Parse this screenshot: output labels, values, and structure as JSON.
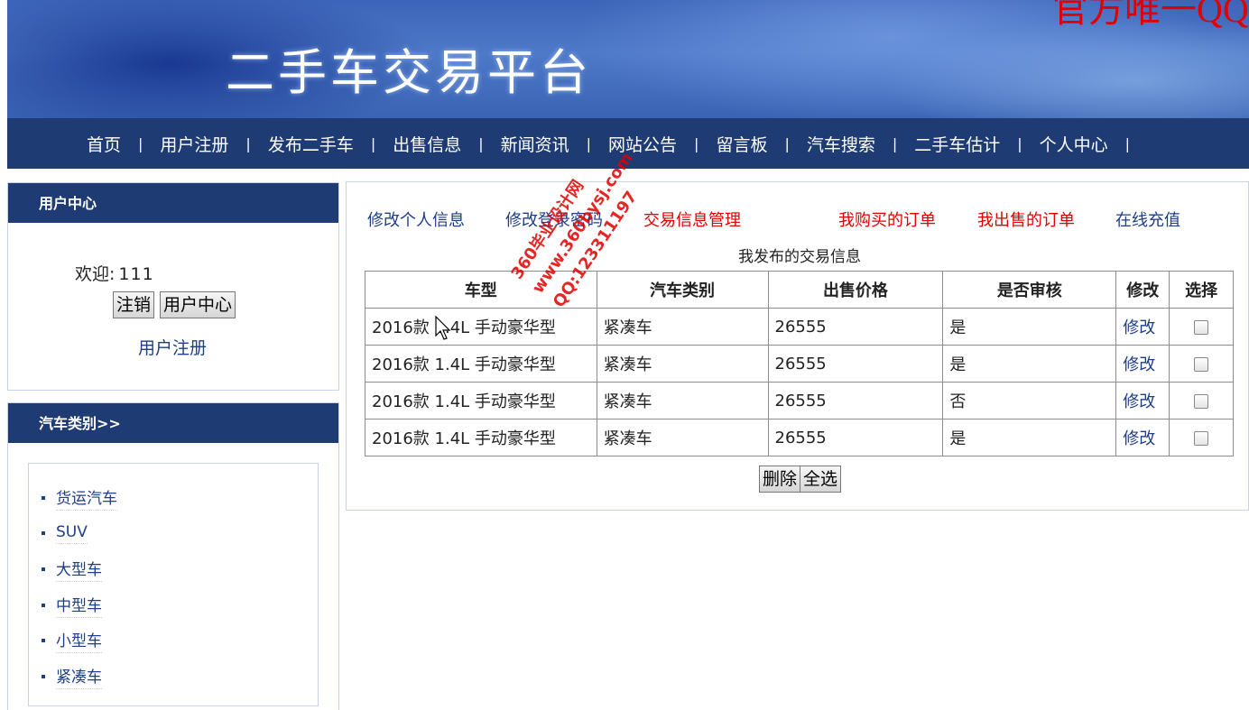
{
  "banner": {
    "title": "二手车交易平台",
    "corner_text": "官方唯一QQ"
  },
  "nav": {
    "items": [
      "首页",
      "用户注册",
      "发布二手车",
      "出售信息",
      "新闻资讯",
      "网站公告",
      "留言板",
      "汽车搜索",
      "二手车估计",
      "个人中心"
    ],
    "separator": "|"
  },
  "user_center": {
    "title": "用户中心",
    "welcome_label": "欢迎:",
    "welcome_value": "111",
    "logout_button": "注销",
    "user_center_button": "用户中心",
    "register_link": "用户注册"
  },
  "categories": {
    "title": "汽车类别>>",
    "items": [
      "货运汽车",
      "SUV",
      "大型车",
      "中型车",
      "小型车",
      "紧凑车"
    ]
  },
  "tabs": [
    {
      "label": "修改个人信息",
      "color": "#1f3e88"
    },
    {
      "label": "修改登录密码",
      "color": "#1f3e88"
    },
    {
      "label": "交易信息管理",
      "color": "#e00000"
    },
    {
      "label": "我购买的订单",
      "color": "#e00000"
    },
    {
      "label": "我出售的订单",
      "color": "#e00000"
    },
    {
      "label": "在线充值",
      "color": "#1f3e88"
    }
  ],
  "table": {
    "caption": "我发布的交易信息",
    "headers": [
      "车型",
      "汽车类别",
      "出售价格",
      "是否审核",
      "修改",
      "选择"
    ],
    "rows": [
      {
        "model": "2016款 1.4L 手动豪华型",
        "category": "紧凑车",
        "price": "26555",
        "approved": "是",
        "edit": "修改"
      },
      {
        "model": "2016款 1.4L 手动豪华型",
        "category": "紧凑车",
        "price": "26555",
        "approved": "是",
        "edit": "修改"
      },
      {
        "model": "2016款 1.4L 手动豪华型",
        "category": "紧凑车",
        "price": "26555",
        "approved": "否",
        "edit": "修改"
      },
      {
        "model": "2016款 1.4L 手动豪华型",
        "category": "紧凑车",
        "price": "26555",
        "approved": "是",
        "edit": "修改"
      }
    ],
    "delete_button": "删除",
    "select_all_button": "全选"
  },
  "watermark": {
    "line1": "360毕业设计网",
    "line2": "www.360bysj.com",
    "line3": "QQ:123311197"
  },
  "colors": {
    "nav_bg": "#1f3b73",
    "link_blue": "#1f3e88",
    "active_red": "#e00000",
    "banner_blue": "#3c64b8"
  }
}
